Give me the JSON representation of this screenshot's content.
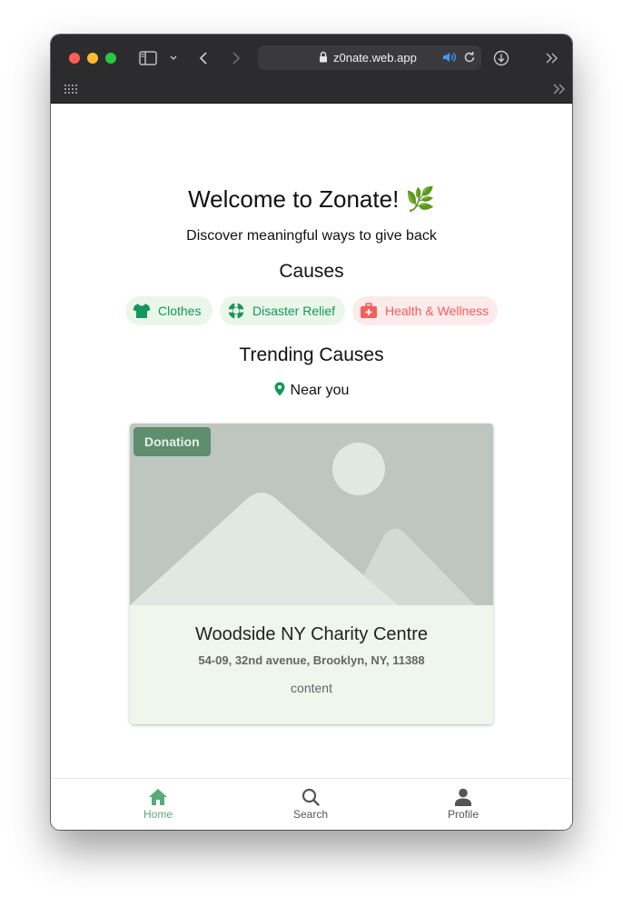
{
  "browser": {
    "url": "z0nate.web.app"
  },
  "page": {
    "title": "Welcome to Zonate! 🌿",
    "subtitle": "Discover meaningful ways to give back",
    "causes_heading": "Causes",
    "trending_heading": "Trending Causes",
    "near_label": "Near you"
  },
  "causes": [
    {
      "label": "Clothes",
      "icon": "shirt-icon",
      "color": "#15975b",
      "bg": "#eaf6ea"
    },
    {
      "label": "Disaster Relief",
      "icon": "lifebuoy-icon",
      "color": "#15975b",
      "bg": "#eaf6ea"
    },
    {
      "label": "Health & Wellness",
      "icon": "first-aid-kit-icon",
      "color": "#f25f5c",
      "bg": "#fdeaea"
    }
  ],
  "card": {
    "badge": "Donation",
    "title": "Woodside NY Charity Centre",
    "address": "54-09, 32nd avenue, Brooklyn, NY, 11388",
    "content": "content"
  },
  "nav": {
    "home": "Home",
    "search": "Search",
    "profile": "Profile"
  },
  "colors": {
    "accent": "#15975b",
    "nav_active": "#5aaa78",
    "nav_inactive": "#555555",
    "health": "#f25f5c"
  }
}
